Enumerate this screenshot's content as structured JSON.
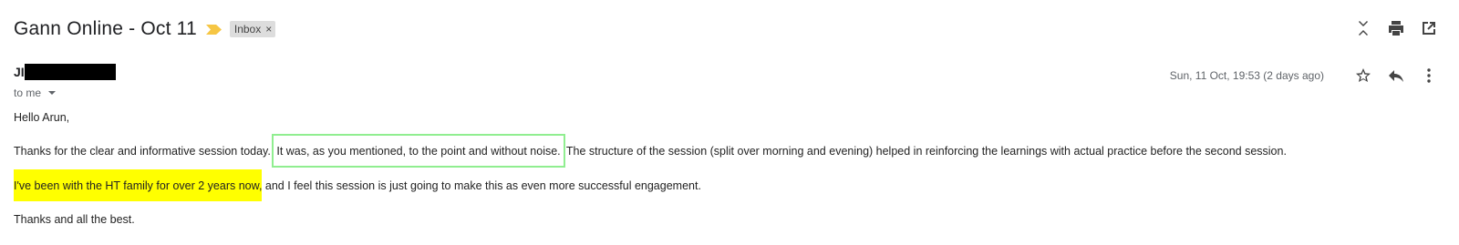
{
  "header": {
    "subject": "Gann Online - Oct 11",
    "label": "Inbox",
    "label_remove": "×",
    "importance_icon": "importance-marker-icon",
    "actions": [
      "collapse-all-icon",
      "print-icon",
      "open-in-new-window-icon"
    ]
  },
  "message": {
    "sender_visible": "JI",
    "to_line": "to me",
    "date": "Sun, 11 Oct, 19:53 (2 days ago)",
    "actions": [
      "star-icon",
      "reply-icon",
      "more-vertical-icon"
    ]
  },
  "body": {
    "greeting": "Hello Arun,",
    "p1_before": "Thanks for the clear and informative session today.",
    "p1_boxed": "It was, as you mentioned, to the point and without noise.",
    "p1_after": "The structure of the session (split over morning and evening) helped in reinforcing the learnings with actual practice before the second session.",
    "p2_highlight": "I've been with the HT family for over 2 years now,",
    "p2_after": " and I feel this session is just going to make this as even more successful engagement.",
    "closing": "Thanks and all the best."
  },
  "colors": {
    "highlight_yellow": "#ffff00",
    "box_green": "#90ee90",
    "importance_yellow": "#f6c644"
  }
}
